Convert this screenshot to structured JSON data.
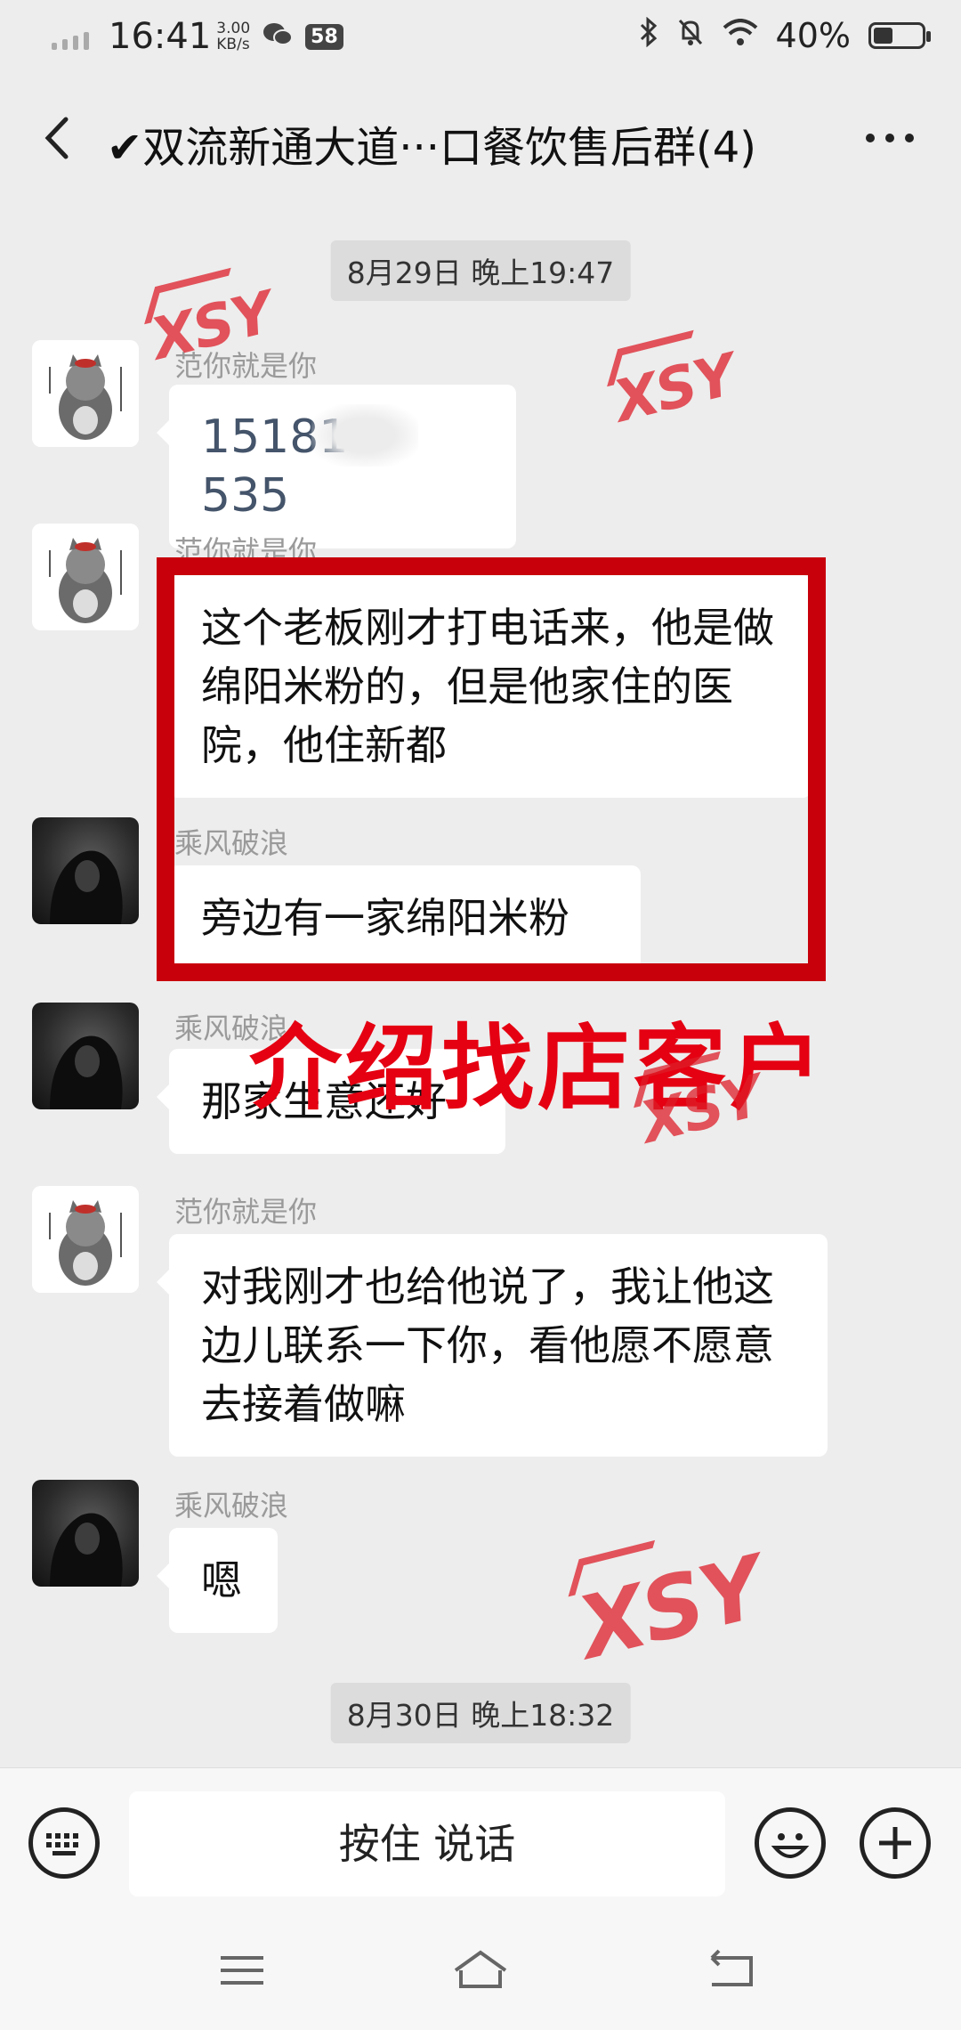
{
  "status_bar": {
    "time": "16:41",
    "net_speed_value": "3.00",
    "net_speed_unit": "KB/s",
    "notification_count": "58",
    "battery": "40%",
    "battery_level": 0.4
  },
  "header": {
    "title": "✔双流新通大道···口餐饮售后群(4)"
  },
  "messages": {
    "ts1": "8月29日 晚上19:47",
    "m1_sender": "范你就是你",
    "m1_left": "15181",
    "m1_right": "535",
    "m2_sender": "范你就是你",
    "m2_text": "这个老板刚才打电话来，他是做绵阳米粉的，但是他家住的医院，他住新都",
    "m3_sender": "乘风破浪",
    "m3_text": "旁边有一家绵阳米粉",
    "m4_sender": "乘风破浪",
    "m4_text": "那家生意还好",
    "m5_sender": "范你就是你",
    "m5_text": "对我刚才也给他说了，我让他这边儿联系一下你，看他愿不愿意去接着做嘛",
    "m6_sender": "乘风破浪",
    "m6_text": "嗯",
    "ts2": "8月30日 晚上18:32"
  },
  "overlay": {
    "caption": "介绍找店客户",
    "watermark": "XSY",
    "color": "#e50012"
  },
  "input_bar": {
    "hold_to_talk": "按住 说话"
  }
}
